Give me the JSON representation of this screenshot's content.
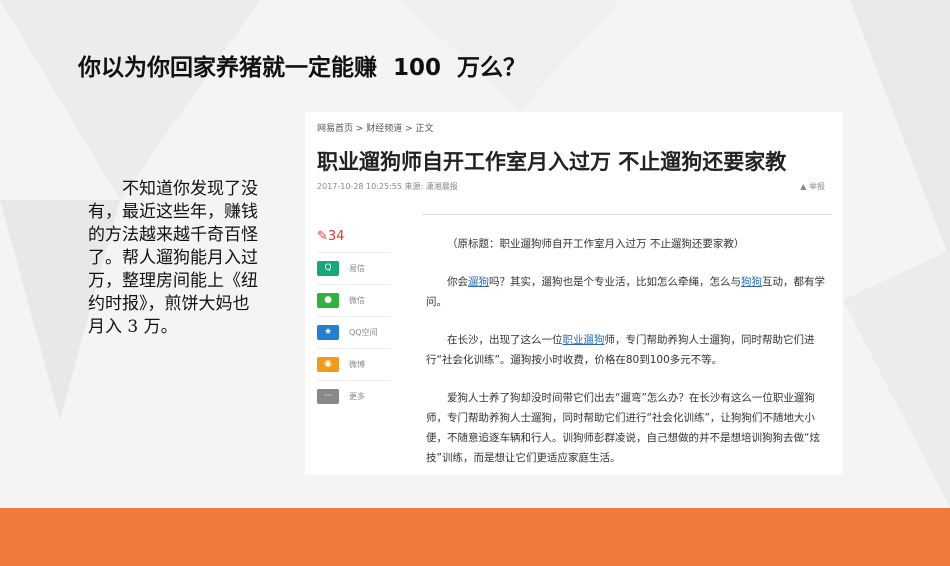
{
  "slide": {
    "title": "你以为你回家养猪就一定能赚  100  万么？",
    "side_text": "不知道你发现了没有，最近这些年，赚钱的方法越来越千奇百怪了。帮人遛狗能月入过万，整理房间能上《纽约时报》，煎饼大妈也月入  3  万。"
  },
  "article": {
    "breadcrumb": "网易首页 > 财经频道 > 正文",
    "headline": "职业遛狗师自开工作室月入过万 不止遛狗还要家教",
    "meta": "2017-10-28 10:25:55  来源: 潇湘晨报",
    "report": "举报",
    "comment_count": "34",
    "share": [
      {
        "label": "易信",
        "icon": "yixin-icon",
        "color": "#1aa57a",
        "glyph": "Q"
      },
      {
        "label": "微信",
        "icon": "wechat-icon",
        "color": "#2fb13a",
        "glyph": "●"
      },
      {
        "label": "QQ空间",
        "icon": "qzone-icon",
        "color": "#2280d0",
        "glyph": "★"
      },
      {
        "label": "微博",
        "icon": "weibo-icon",
        "color": "#f09a1a",
        "glyph": "◉"
      },
      {
        "label": "更多",
        "icon": "more-icon",
        "color": "#888888",
        "glyph": "···"
      }
    ],
    "p1": "（原标题：职业遛狗师自开工作室月入过万 不止遛狗还要家教）",
    "p2a": "你会",
    "p2l1": "遛狗",
    "p2b": "吗？其实，遛狗也是个专业活，比如怎么牵绳，怎么与",
    "p2l2": "狗狗",
    "p2c": "互动，都有学问。",
    "p3a": "在长沙，出现了这么一位",
    "p3l": "职业遛狗",
    "p3b": "师，专门帮助养狗人士遛狗，同时帮助它们进行“社会化训练”。遛狗按小时收费，价格在80到100多元不等。",
    "p4": "爱狗人士养了狗却没时间带它们出去“遛弯”怎么办？在长沙有这么一位职业遛狗师，专门帮助养狗人士遛狗，同时帮助它们进行“社会化训练”，让狗狗们不随地大小便，不随意追逐车辆和行人。训狗师彭群凌说，自己想做的并不是想培训狗狗去做“炫技”训练，而是想让它们更适应家庭生活。"
  }
}
